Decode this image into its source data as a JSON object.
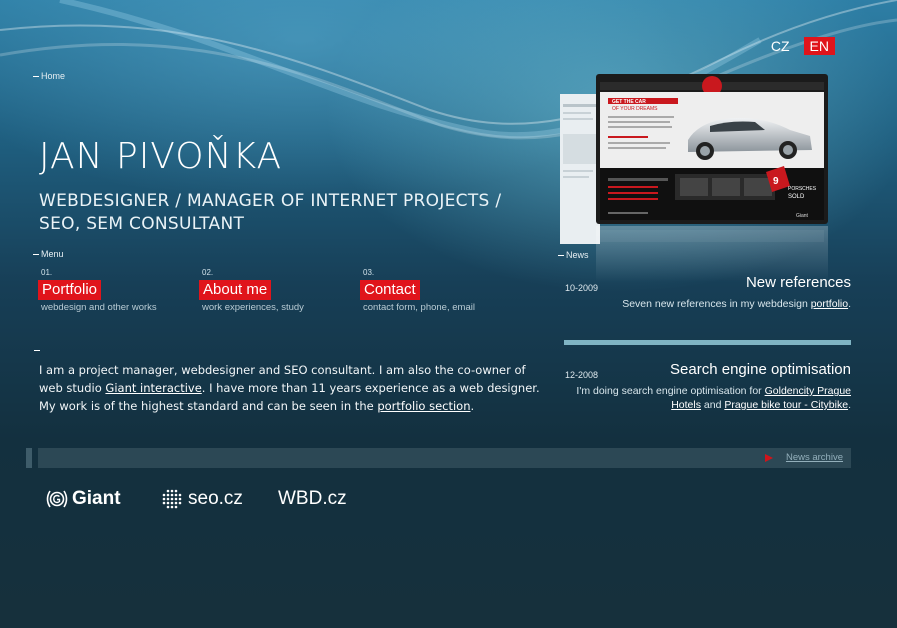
{
  "lang": {
    "cz": "CZ",
    "en": "EN",
    "active": "EN"
  },
  "breadcrumb": {
    "home": "Home"
  },
  "header": {
    "name": "JAN PIVOŇKA",
    "subtitle_line1": "WEBDESIGNER / MANAGER OF INTERNET PROJECTS /",
    "subtitle_line2": "SEO, SEM CONSULTANT"
  },
  "menu": {
    "label": "Menu",
    "items": [
      {
        "num": "01.",
        "label": "Portfolio",
        "desc": "webdesign and other works"
      },
      {
        "num": "02.",
        "label": "About me",
        "desc": "work experiences, study"
      },
      {
        "num": "03.",
        "label": "Contact",
        "desc": "contact form, phone, email"
      }
    ]
  },
  "intro": {
    "part1": "I am a project manager, webdesigner and SEO consultant. I am also the co-owner of web studio ",
    "link1": "Giant interactive",
    "part2": ". I have more than 11 years experience as a web designer. My work is of the highest standard and can be seen in the ",
    "link2": "portfolio section",
    "part3": "."
  },
  "news": {
    "label": "News",
    "items": [
      {
        "date": "10-2009",
        "title": "New references",
        "text": "Seven new references in my webdesign ",
        "link": "portfolio",
        "tail": "."
      },
      {
        "date": "12-2008",
        "title": "Search engine optimisation",
        "text": "I'm doing search engine optimisation for ",
        "link1": "Goldencity Prague Hotels",
        "mid": " and ",
        "link2": "Prague bike tour - Citybike",
        "tail": "."
      }
    ],
    "archive": "News archive"
  },
  "screenshot": {
    "headline1": "GET THE CAR",
    "headline2": "OF YOUR DREAMS",
    "sold_number": "9",
    "sold_text1": "PORSCHES",
    "sold_text2": "SOLD",
    "brand": "Giant"
  },
  "logos": {
    "giant": "Giant",
    "seo": "seo.cz",
    "wbd": "WBD.cz"
  },
  "colors": {
    "accent": "#e0141b",
    "background": "#173f57"
  }
}
